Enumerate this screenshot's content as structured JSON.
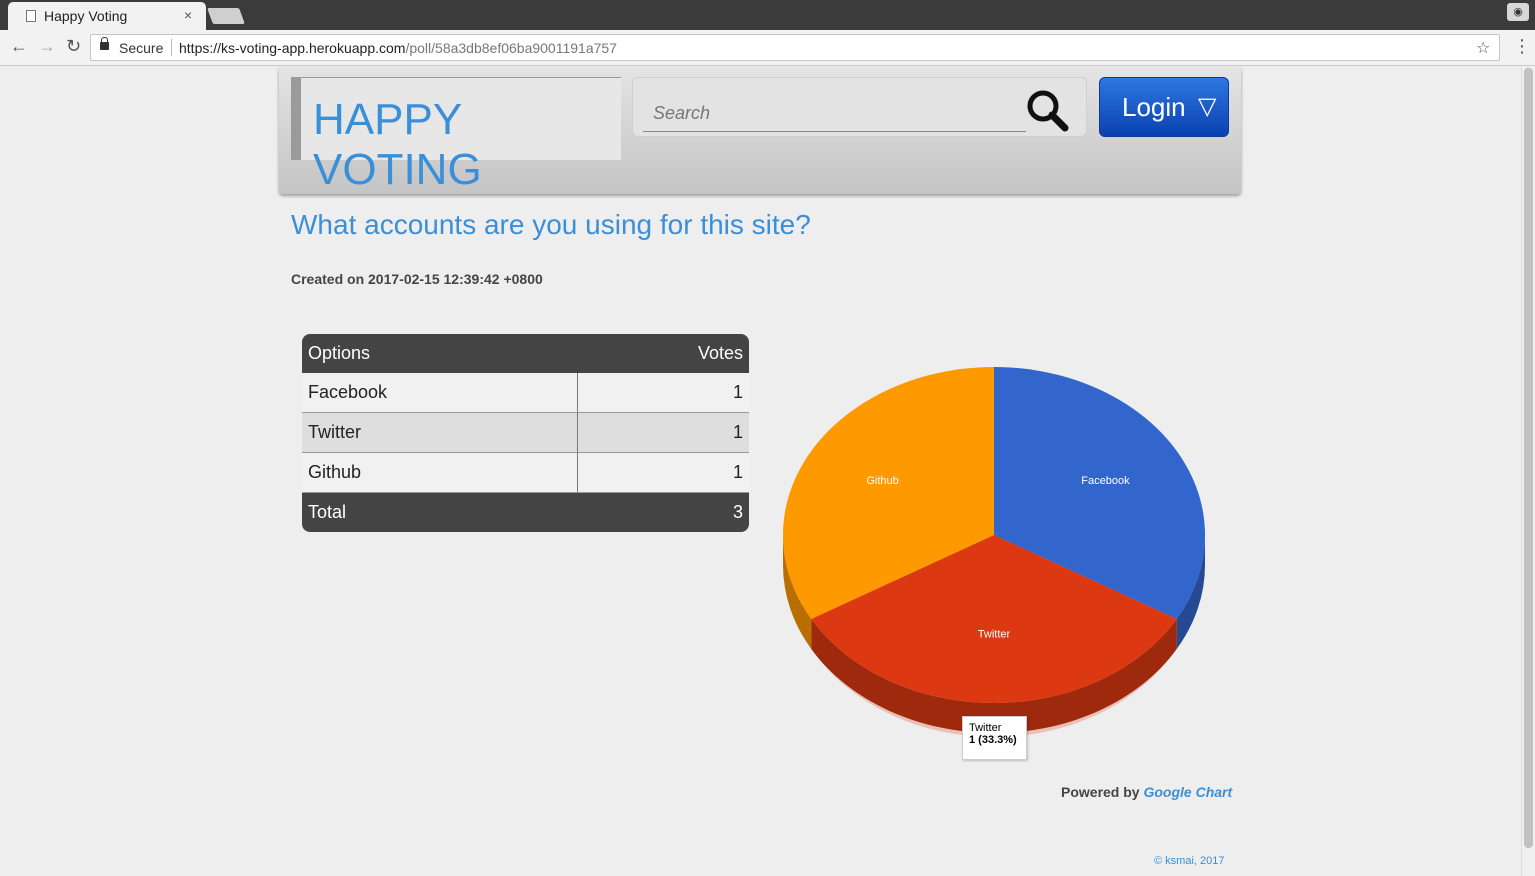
{
  "browser": {
    "tab_title": "Happy Voting",
    "tab_close": "×",
    "secure_label": "Secure",
    "url_host": "https://ks-voting-app.herokuapp.com",
    "url_path": "/poll/58a3db8ef06ba9001191a757"
  },
  "header": {
    "logo": "HAPPY VOTING",
    "search_placeholder": "Search",
    "login_label": "Login",
    "login_arrow": "▽"
  },
  "poll": {
    "question": "What accounts are you using for this site?",
    "created": "Created on 2017-02-15 12:39:42 +0800",
    "table": {
      "col_options": "Options",
      "col_votes": "Votes",
      "rows": [
        {
          "option": "Facebook",
          "votes": "1"
        },
        {
          "option": "Twitter",
          "votes": "1"
        },
        {
          "option": "Github",
          "votes": "1"
        }
      ],
      "total_label": "Total",
      "total_value": "3"
    }
  },
  "chart_data": {
    "type": "pie",
    "title": "",
    "categories": [
      "Facebook",
      "Twitter",
      "Github"
    ],
    "values": [
      1,
      1,
      1
    ],
    "colors": [
      "#3366cc",
      "#dc3912",
      "#ff9900"
    ],
    "three_d": true,
    "tooltip": {
      "label": "Twitter",
      "value": "1 (33.3%)"
    }
  },
  "powered": {
    "prefix": "Powered by",
    "link": "Google Chart"
  },
  "footer": "© ksmai, 2017"
}
